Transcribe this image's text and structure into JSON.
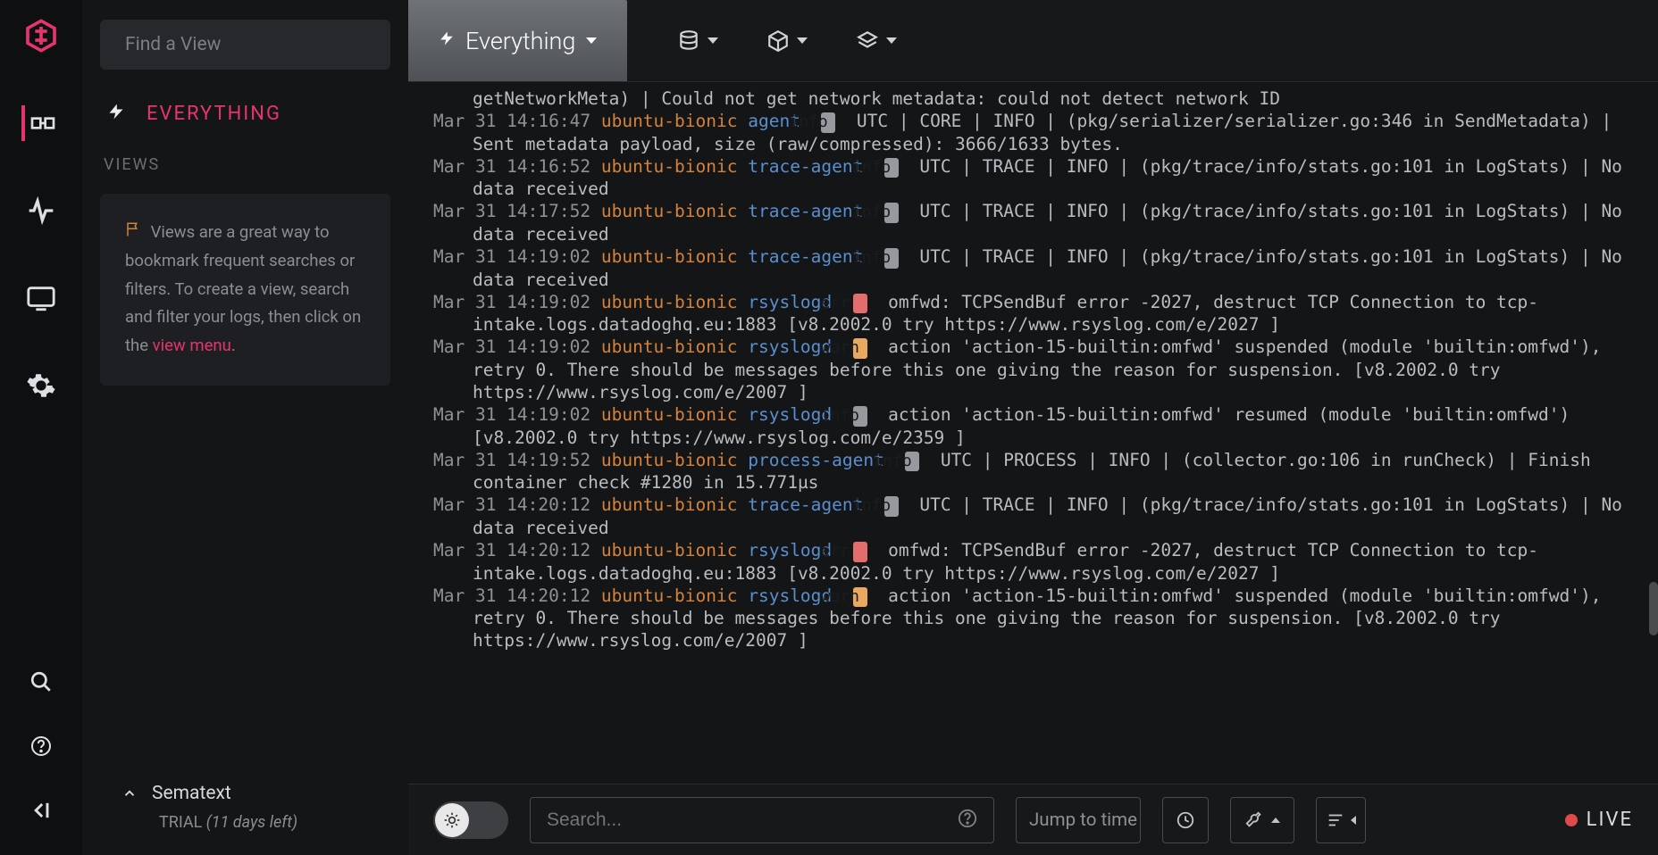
{
  "sidebar": {
    "find_placeholder": "Find a View",
    "current_view": "EVERYTHING",
    "views_heading": "VIEWS",
    "views_tip": {
      "prefix": "Views are a great way to bookmark frequent searches or filters. To create a view, search and filter your logs, then click on the ",
      "link": "view menu",
      "suffix": "."
    },
    "brand": "Sematext",
    "trial_label": "TRIAL ",
    "trial_remaining": "(11 days left)"
  },
  "topbar": {
    "main_label": "Everything"
  },
  "bottom": {
    "search_placeholder": "Search...",
    "jump_placeholder": "Jump to time",
    "live_label": "LIVE"
  },
  "log_cut_top": "getNetworkMeta) | Could not get network metadata: could not detect network ID",
  "logs": [
    {
      "ts": "Mar 31 14:16:47",
      "host": "ubuntu-bionic",
      "svc": "agent",
      "lvl": "info",
      "msg": "UTC | CORE | INFO | (pkg/serializer/serializer.go:346 in SendMetadata) | Sent metadata payload, size (raw/compressed): 3666/1633 bytes."
    },
    {
      "ts": "Mar 31 14:16:52",
      "host": "ubuntu-bionic",
      "svc": "trace-agent",
      "lvl": "info",
      "msg": "UTC | TRACE | INFO | (pkg/trace/info/stats.go:101 in LogStats) | No data received"
    },
    {
      "ts": "Mar 31 14:17:52",
      "host": "ubuntu-bionic",
      "svc": "trace-agent",
      "lvl": "info",
      "msg": "UTC | TRACE | INFO | (pkg/trace/info/stats.go:101 in LogStats) | No data received"
    },
    {
      "ts": "Mar 31 14:19:02",
      "host": "ubuntu-bionic",
      "svc": "trace-agent",
      "lvl": "info",
      "msg": "UTC | TRACE | INFO | (pkg/trace/info/stats.go:101 in LogStats) | No data received"
    },
    {
      "ts": "Mar 31 14:19:02",
      "host": "ubuntu-bionic",
      "svc": "rsyslogd",
      "lvl": "err",
      "msg": "omfwd: TCPSendBuf error -2027, destruct TCP Connection to tcp-intake.logs.datadoghq.eu:1883 [v8.2002.0 try https://www.rsyslog.com/e/2027 ]"
    },
    {
      "ts": "Mar 31 14:19:02",
      "host": "ubuntu-bionic",
      "svc": "rsyslogd",
      "lvl": "warn",
      "msg": "action 'action-15-builtin:omfwd' suspended (module 'builtin:omfwd'), retry 0. There should be messages before this one giving the reason for suspension. [v8.2002.0 try https://www.rsyslog.com/e/2007 ]"
    },
    {
      "ts": "Mar 31 14:19:02",
      "host": "ubuntu-bionic",
      "svc": "rsyslogd",
      "lvl": "info",
      "msg": "action 'action-15-builtin:omfwd' resumed (module 'builtin:omfwd') [v8.2002.0 try https://www.rsyslog.com/e/2359 ]"
    },
    {
      "ts": "Mar 31 14:19:52",
      "host": "ubuntu-bionic",
      "svc": "process-agent",
      "lvl": "info",
      "msg": "UTC | PROCESS | INFO | (collector.go:106 in runCheck) | Finish container check #1280 in 15.771µs"
    },
    {
      "ts": "Mar 31 14:20:12",
      "host": "ubuntu-bionic",
      "svc": "trace-agent",
      "lvl": "info",
      "msg": "UTC | TRACE | INFO | (pkg/trace/info/stats.go:101 in LogStats) | No data received"
    },
    {
      "ts": "Mar 31 14:20:12",
      "host": "ubuntu-bionic",
      "svc": "rsyslogd",
      "lvl": "err",
      "msg": "omfwd: TCPSendBuf error -2027, destruct TCP Connection to tcp-intake.logs.datadoghq.eu:1883 [v8.2002.0 try https://www.rsyslog.com/e/2027 ]"
    },
    {
      "ts": "Mar 31 14:20:12",
      "host": "ubuntu-bionic",
      "svc": "rsyslogd",
      "lvl": "warn",
      "msg": "action 'action-15-builtin:omfwd' suspended (module 'builtin:omfwd'), retry 0. There should be messages before this one giving the reason for suspension. [v8.2002.0 try https://www.rsyslog.com/e/2007 ]"
    }
  ]
}
